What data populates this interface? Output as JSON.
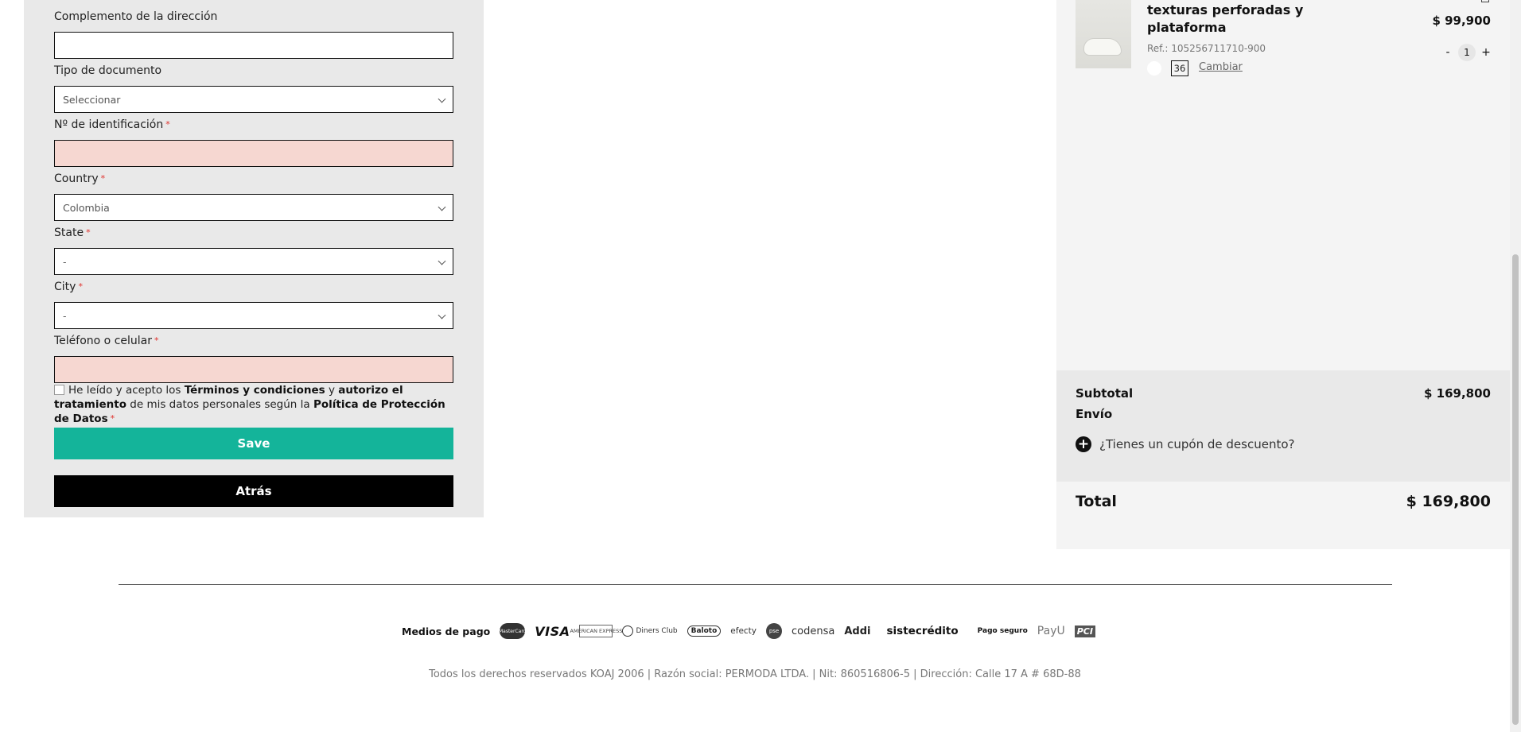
{
  "form": {
    "address_complement_label": "Complemento de la dirección",
    "address_complement_value": "",
    "document_type_label": "Tipo de documento",
    "document_type_value": "Seleccionar",
    "id_number_label": "Nº de identificación",
    "id_number_value": "",
    "country_label": "Country",
    "country_value": "Colombia",
    "state_label": "State",
    "state_value": "-",
    "city_label": "City",
    "city_value": "-",
    "phone_label": "Teléfono o celular",
    "phone_value": "",
    "required_mark": "*",
    "consent": {
      "prefix": "He leído y acepto los ",
      "terms": "Términos y condiciones",
      "middle": " y ",
      "authorize": "autorizo el tratamiento",
      "suffix": " de mis datos personales según la ",
      "policy": "Política de Protección de Datos",
      "checked": false
    },
    "save_label": "Save",
    "back_label": "Atrás"
  },
  "cart": {
    "item": {
      "name": "texturas perforadas y plataforma",
      "ref": "Ref.: 105256711710-900",
      "price": "$ 99,900",
      "size": "36",
      "change_label": "Cambiar",
      "quantity": "1",
      "decrement": "-",
      "increment": "+",
      "color_hex": "#ffffff"
    },
    "subtotal_label": "Subtotal",
    "subtotal_value": "$ 169,800",
    "shipping_label": "Envío",
    "coupon_label": "¿Tienes un cupón de descuento?",
    "total_label": "Total",
    "total_value": "$ 169,800"
  },
  "footer": {
    "payments_title": "Medios de pago",
    "logos": {
      "mastercard": "MasterCard",
      "visa": "VISA",
      "amex": "AMERICAN EXPRESS",
      "diners": "Diners Club",
      "baloto": "Baloto",
      "efecty": "efecty",
      "pse": "pse",
      "codensa": "codensa",
      "addi": "Addi",
      "sistecredito": "sistecrédito",
      "secure": "Pago seguro",
      "payu": "PayU",
      "pci": "PCI"
    },
    "legal": "Todos los derechos reservados KOAJ 2006 | Razón social: PERMODA LTDA. | Nit: 860516806-5 | Dirección: Calle 17 A # 68D-88"
  },
  "colors": {
    "save_button": "#14b49a",
    "back_button": "#000000",
    "error_field": "#f6d7d1",
    "required_mark": "#e0312c"
  }
}
